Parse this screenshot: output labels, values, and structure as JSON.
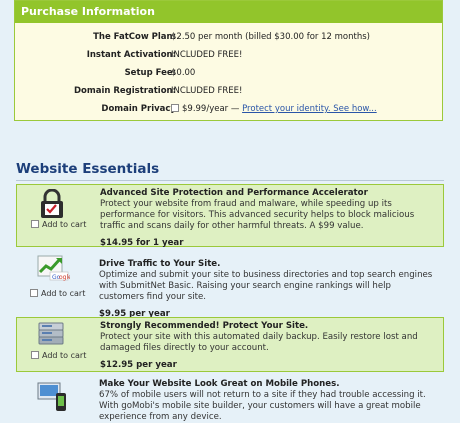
{
  "purchase": {
    "header": "Purchase Information",
    "rows": [
      {
        "label": "The FatCow Plan:",
        "value": "$2.50 per month (billed $30.00 for 12 months)"
      },
      {
        "label": "Instant Activation:",
        "value": "INCLUDED FREE!"
      },
      {
        "label": "Setup Fee:",
        "value": "$0.00"
      },
      {
        "label": "Domain Registration:",
        "value": "INCLUDED FREE!"
      }
    ],
    "privacy": {
      "label": "Domain Privacy",
      "price": "$9.99/year —",
      "link": "Protect your identity. See how..."
    }
  },
  "section_title": "Website Essentials",
  "cart_label": "Add to cart",
  "items": [
    {
      "title": "Advanced Site Protection and Performance Accelerator",
      "desc": "Protect your website from fraud and malware, while speeding up its performance for visitors. This advanced security helps to block malicious traffic and scans daily for other harmful threats. A $99 value.",
      "price": "$14.95 for 1 year",
      "icon": "padlock-check-icon",
      "highlighted": true
    },
    {
      "title": "Drive Traffic to Your Site.",
      "desc": "Optimize and submit your site to business directories and top search engines with SubmitNet Basic. Raising your search engine rankings will help customers find your site.",
      "price": "$9.95 per year",
      "icon": "traffic-chart-google-icon",
      "highlighted": false
    },
    {
      "title": "Strongly Recommended! Protect Your Site.",
      "desc": "Protect your site with this automated daily backup. Easily restore lost and damaged files directly to your account.",
      "price": "$12.95 per year",
      "icon": "backup-drive-icon",
      "highlighted": true
    },
    {
      "title": "Make Your Website Look Great on Mobile Phones.",
      "desc": "67% of mobile users will not return to a site if they had trouble accessing it. With goMobi's mobile site builder, your customers will have a great mobile experience from any device.",
      "price": "",
      "icon": "mobile-site-icon",
      "highlighted": false
    }
  ]
}
